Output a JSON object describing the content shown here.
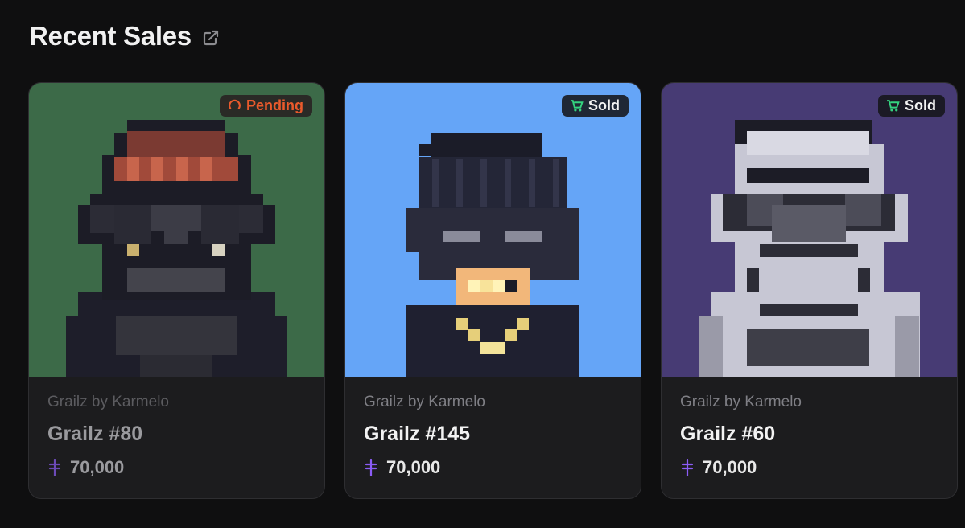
{
  "section": {
    "title": "Recent Sales",
    "link_icon": "external-link-icon"
  },
  "cards": [
    {
      "status": "Pending",
      "status_icon": "spinner-icon",
      "collection": "Grailz by Karmelo",
      "name": "Grailz #80",
      "price": "70,000",
      "currency_icon": "ordinals-currency-icon",
      "background": "#3c6a48"
    },
    {
      "status": "Sold",
      "status_icon": "cart-icon",
      "collection": "Grailz by Karmelo",
      "name": "Grailz #145",
      "price": "70,000",
      "currency_icon": "ordinals-currency-icon",
      "background": "#65a5f7"
    },
    {
      "status": "Sold",
      "status_icon": "cart-icon",
      "collection": "Grailz by Karmelo",
      "name": "Grailz #60",
      "price": "70,000",
      "currency_icon": "ordinals-currency-icon",
      "background": "#473b74"
    }
  ],
  "colors": {
    "page_bg": "#0f0f10",
    "card_bg": "#1c1c1e",
    "pending": "#ea5a2c",
    "sold_icon": "#34d27f",
    "currency": "#8b5cf6"
  }
}
